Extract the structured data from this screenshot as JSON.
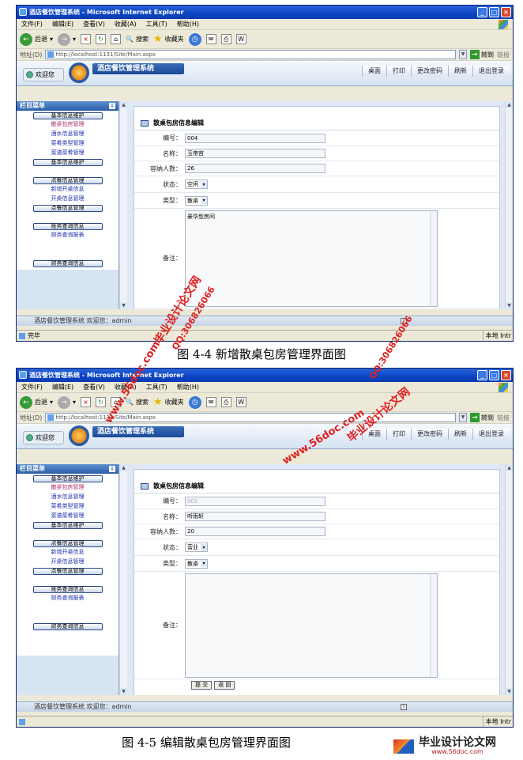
{
  "browser": {
    "title": "酒店餐饮管理系统 - Microsoft Internet Explorer",
    "menu": [
      "文件(F)",
      "编辑(E)",
      "查看(V)",
      "收藏(A)",
      "工具(T)",
      "帮助(H)"
    ],
    "back_label": "后退",
    "search_label": "搜索",
    "favorites_label": "收藏夹",
    "address_label": "地址(D)",
    "url": "http://localhost:1131/Site/Main.aspx",
    "go_label": "转到",
    "links_label": "链接",
    "status_done": "完毕",
    "zone_label": "本地 Intr"
  },
  "app": {
    "welcome": "欢迎您",
    "title": "酒店餐饮管理系统",
    "topnav": [
      "桌面",
      "打印",
      "更改密码",
      "刷新",
      "退出登录"
    ],
    "sidebar_title": "栏目菜单",
    "sidebar": {
      "group1": "基本信息维护",
      "group1_items": [
        "散桌包房管理",
        "酒水信息管理",
        "菜肴类型管理",
        "菜谱菜肴管理"
      ],
      "group1_footer": "基本信息维护",
      "group2": "点餐信息管理",
      "group2_items": [
        "新增开桌信息",
        "开桌信息管理"
      ],
      "group2_footer": "点餐信息管理",
      "group3": "账务查询信息",
      "group3_items": [
        "财务查询报表"
      ],
      "group3_footer": "财务查询信息"
    },
    "status": "酒店餐饮管理系统 欢迎您：admin",
    "panel_title": "散桌包房信息编辑",
    "labels": {
      "code": "编号：",
      "name": "名称：",
      "capacity": "容纳人数：",
      "state": "状态：",
      "type": "类型：",
      "remark": "备注："
    },
    "submit": "提 交",
    "back": "返 回"
  },
  "form1": {
    "code": "004",
    "name": "玉帝宫",
    "capacity": "26",
    "state": "空闲",
    "type": "散桌",
    "remark": "豪华型房间"
  },
  "form2": {
    "code": "001",
    "name": "听雨轩",
    "capacity": "20",
    "state": "营业",
    "type": "散桌",
    "remark": ""
  },
  "captions": {
    "fig1": "图 4-4 新增散桌包房管理界面图",
    "fig2": "图 4-5 编辑散桌包房管理界面图"
  },
  "watermarks": {
    "site_cn": "毕业设计论文网",
    "qq": "QQ:306826066",
    "url": "www.56doc.com"
  },
  "footer_logo": {
    "text": "毕业设计论文网",
    "url": "www.56doc.com"
  }
}
